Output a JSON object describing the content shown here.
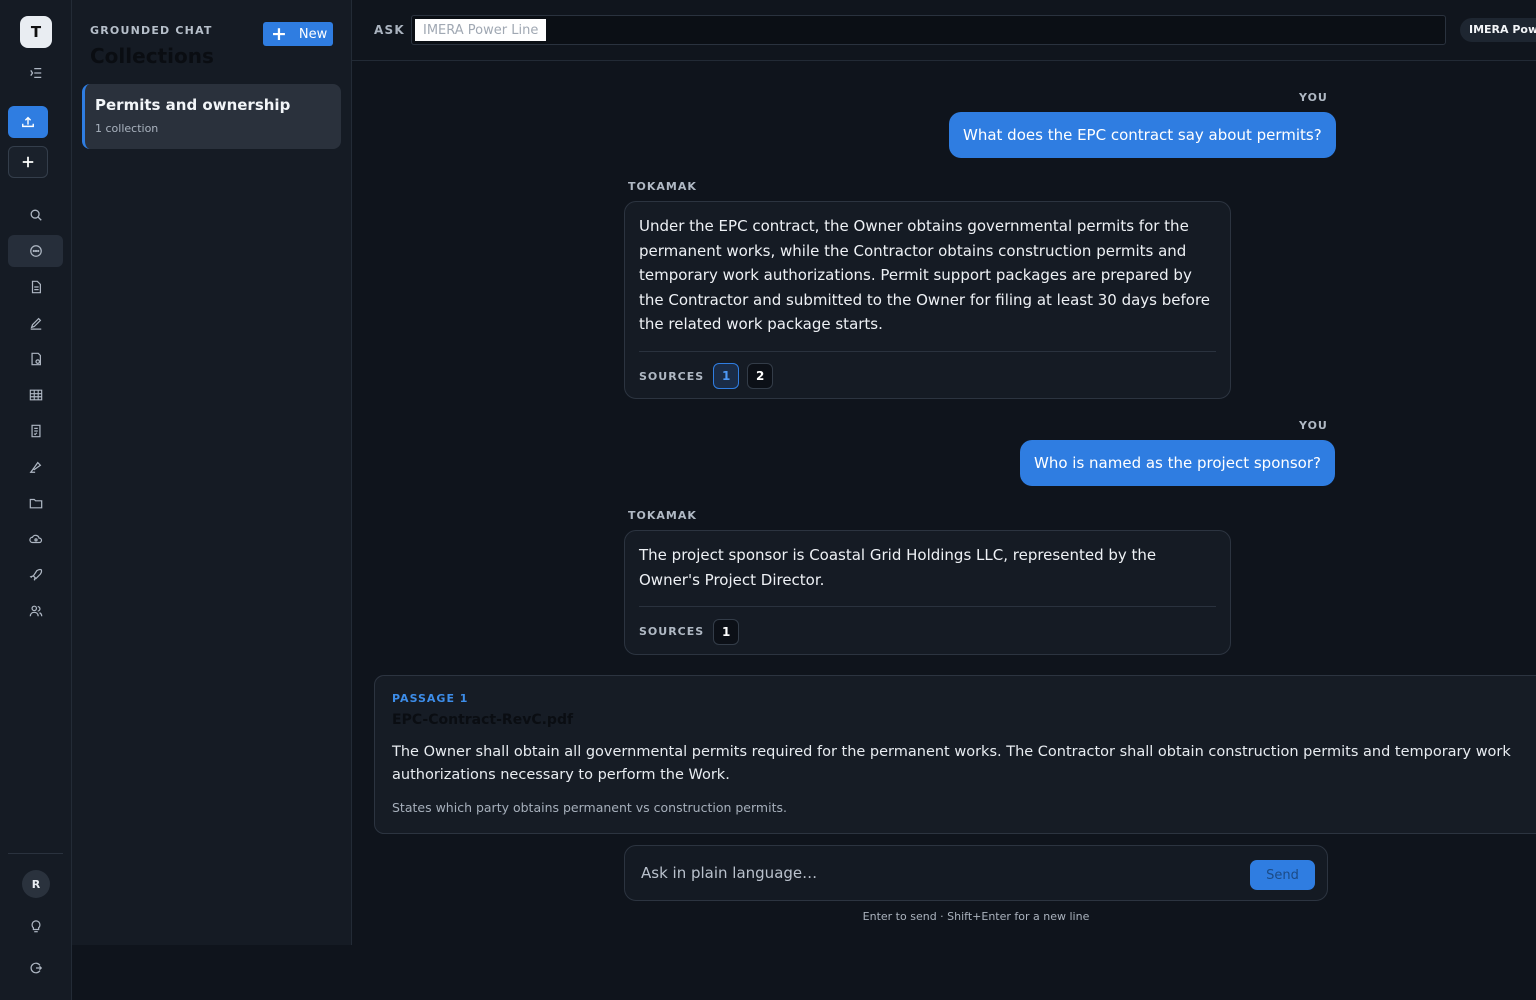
{
  "rail": {
    "workspace_initial": "T",
    "user_initial": "R",
    "icons": [
      "collapse-sidebar-icon",
      "upload-icon",
      "plus-icon",
      "search-icon",
      "chat-icon",
      "document-icon",
      "edit-icon",
      "report-icon",
      "table-icon",
      "checklist-icon",
      "highlighter-icon",
      "folder-icon",
      "cloud-icon",
      "rocket-icon",
      "users-icon",
      "lightbulb-icon",
      "logout-icon"
    ]
  },
  "panel": {
    "kicker": "GROUNDED CHAT",
    "title": "Collections",
    "new_label": "New",
    "items": [
      {
        "name": "Permits and ownership",
        "sub": "1 collection"
      }
    ]
  },
  "topbar": {
    "ask_label": "ASK",
    "ask_value": "IMERA Power Line",
    "scope_chip": "IMERA Power Line"
  },
  "chat": {
    "you_label": "YOU",
    "bot_label": "TOKAMAK",
    "sources_label": "SOURCES",
    "messages": [
      {
        "role": "user",
        "text": "What does the EPC contract say about permits?"
      },
      {
        "role": "bot",
        "text": "Under the EPC contract, the Owner obtains governmental permits for the permanent works, while the Contractor obtains construction permits and temporary work authorizations. Permit support packages are prepared by the Contractor and submitted to the Owner for filing at least 30 days before the related work package starts.",
        "sources": [
          "1",
          "2"
        ]
      },
      {
        "role": "user",
        "text": "Who is named as the project sponsor?"
      },
      {
        "role": "bot",
        "text": "The project sponsor is Coastal Grid Holdings LLC, represented by the Owner's Project Director.",
        "sources": [
          "1"
        ]
      }
    ],
    "passage": {
      "kicker": "PASSAGE 1",
      "file": "EPC-Contract-RevC.pdf",
      "body": "The Owner shall obtain all governmental permits required for the permanent works. The Contractor shall obtain construction permits and temporary work authorizations necessary to perform the Work.",
      "note": "States which party obtains permanent vs construction permits."
    },
    "composer": {
      "placeholder": "Ask in plain language…",
      "send_label": "Send",
      "hint": "Enter to send · Shift+Enter for a new line"
    }
  },
  "colors": {
    "accent": "#2f7de1",
    "background": "#0f141c",
    "panel": "#151b24"
  }
}
